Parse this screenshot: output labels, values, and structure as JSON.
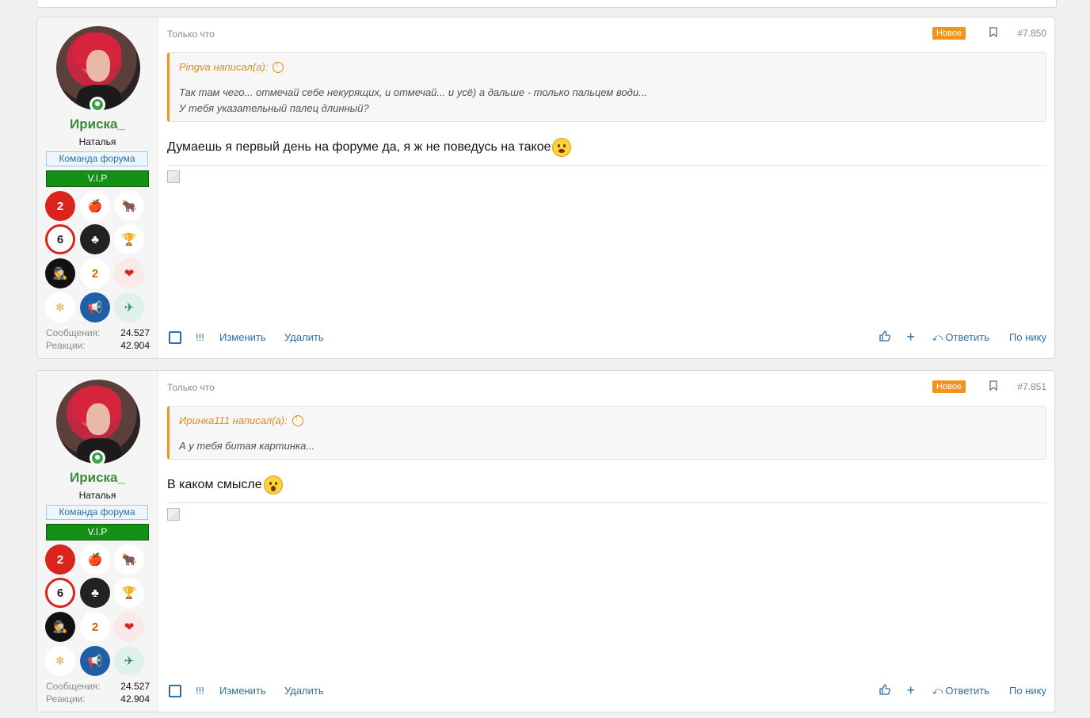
{
  "posts": [
    {
      "user": {
        "name": "Ириска_",
        "title": "Наталья",
        "team_badge": "Команда форума",
        "vip_badge": "V.I.P"
      },
      "stats": {
        "messages_label": "Сообщения:",
        "messages_value": "24.527",
        "reactions_label": "Реакции:",
        "reactions_value": "42.904"
      },
      "time": "Только что",
      "new_label": "Новое",
      "number": "#7.850",
      "quote": {
        "author": "Pingva написал(а):",
        "lines": [
          "Так там чего... отмечай себе некурящих, и отмечай... и усё) а дальше - только пальцем води...",
          "У тебя указательный палец длинный?"
        ]
      },
      "message": "Думаешь я первый день на форуме да, я ж не поведусь на такое"
    },
    {
      "user": {
        "name": "Ириска_",
        "title": "Наталья",
        "team_badge": "Команда форума",
        "vip_badge": "V.I.P"
      },
      "stats": {
        "messages_label": "Сообщения:",
        "messages_value": "24.527",
        "reactions_label": "Реакции:",
        "reactions_value": "42.904"
      },
      "time": "Только что",
      "new_label": "Новое",
      "number": "#7.851",
      "quote": {
        "author": "Иринка111 написал(а):",
        "lines": [
          "А у тебя битая картинка..."
        ]
      },
      "message": "В каком смысле"
    }
  ],
  "actions": {
    "report": "!!!",
    "edit": "Изменить",
    "delete": "Удалить",
    "reply": "Ответить",
    "by_nick": "По нику"
  },
  "colors": {
    "accent": "#f0941d",
    "link": "#2f6fa8",
    "username": "#3a8a3a",
    "vip": "#149114"
  }
}
